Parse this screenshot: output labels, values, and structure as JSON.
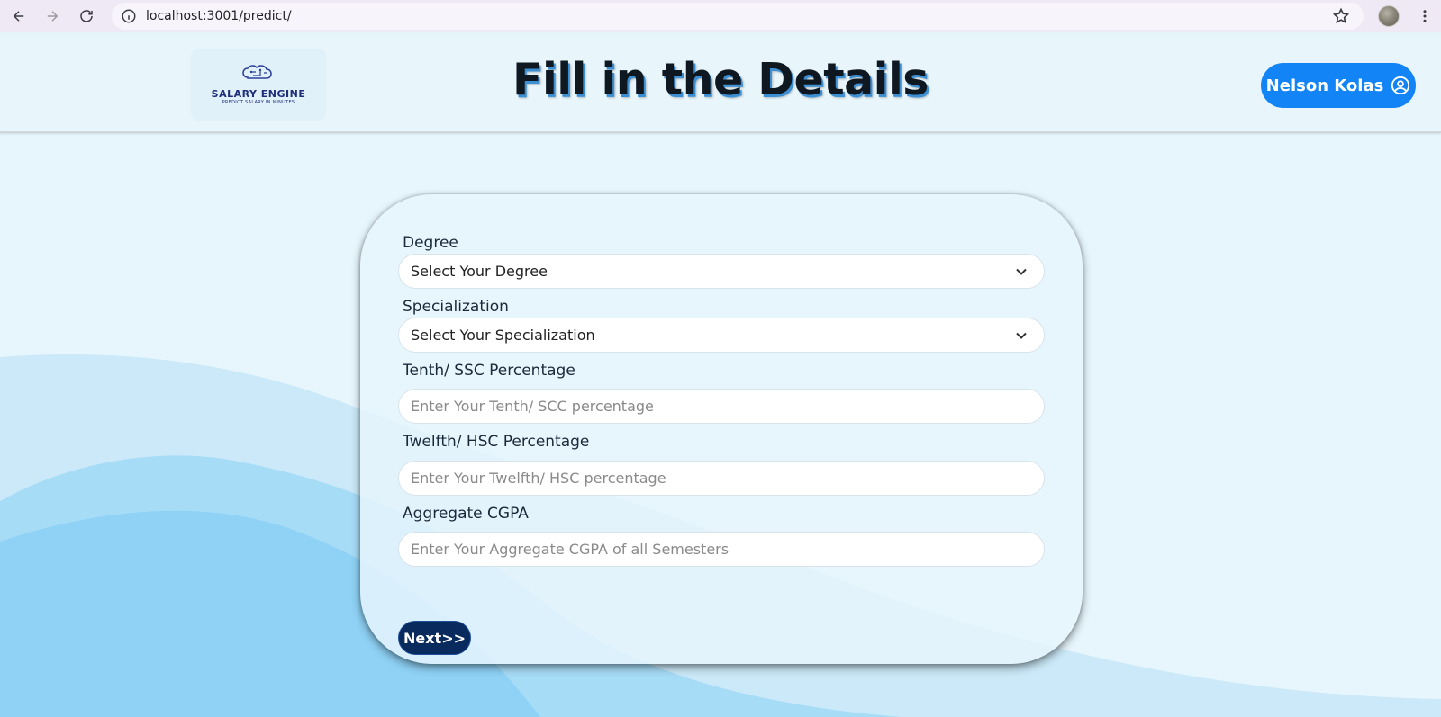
{
  "browser": {
    "url": "localhost:3001/predict/",
    "icons": [
      "back-icon",
      "forward-icon",
      "reload-icon",
      "info-icon",
      "star-icon",
      "kebab-menu-icon"
    ]
  },
  "header": {
    "logo_title": "SALARY ENGINE",
    "logo_tagline": "PREDICT SALARY IN MINUTES",
    "title": "Fill in the Details",
    "user_name": "Nelson Kolas",
    "user_icon": "user-circle-icon"
  },
  "form": {
    "degree_label": "Degree",
    "degree_value": "Select Your Degree",
    "specialization_label": "Specialization",
    "specialization_value": "Select Your Specialization",
    "tenth_label": "Tenth/ SSC Percentage",
    "tenth_placeholder": "Enter Your Tenth/ SCC  percentage",
    "twelfth_label": "Twelfth/ HSC Percentage",
    "twelfth_placeholder": "Enter Your Twelfth/ HSC  percentage",
    "cgpa_label": "Aggregate CGPA",
    "cgpa_placeholder": "Enter Your Aggregate CGPA of all Semesters",
    "next_label": "Next>>"
  },
  "colors": {
    "accent": "#1284f5",
    "next_button": "#092a5c",
    "page_bg": "#e7f6fd"
  }
}
